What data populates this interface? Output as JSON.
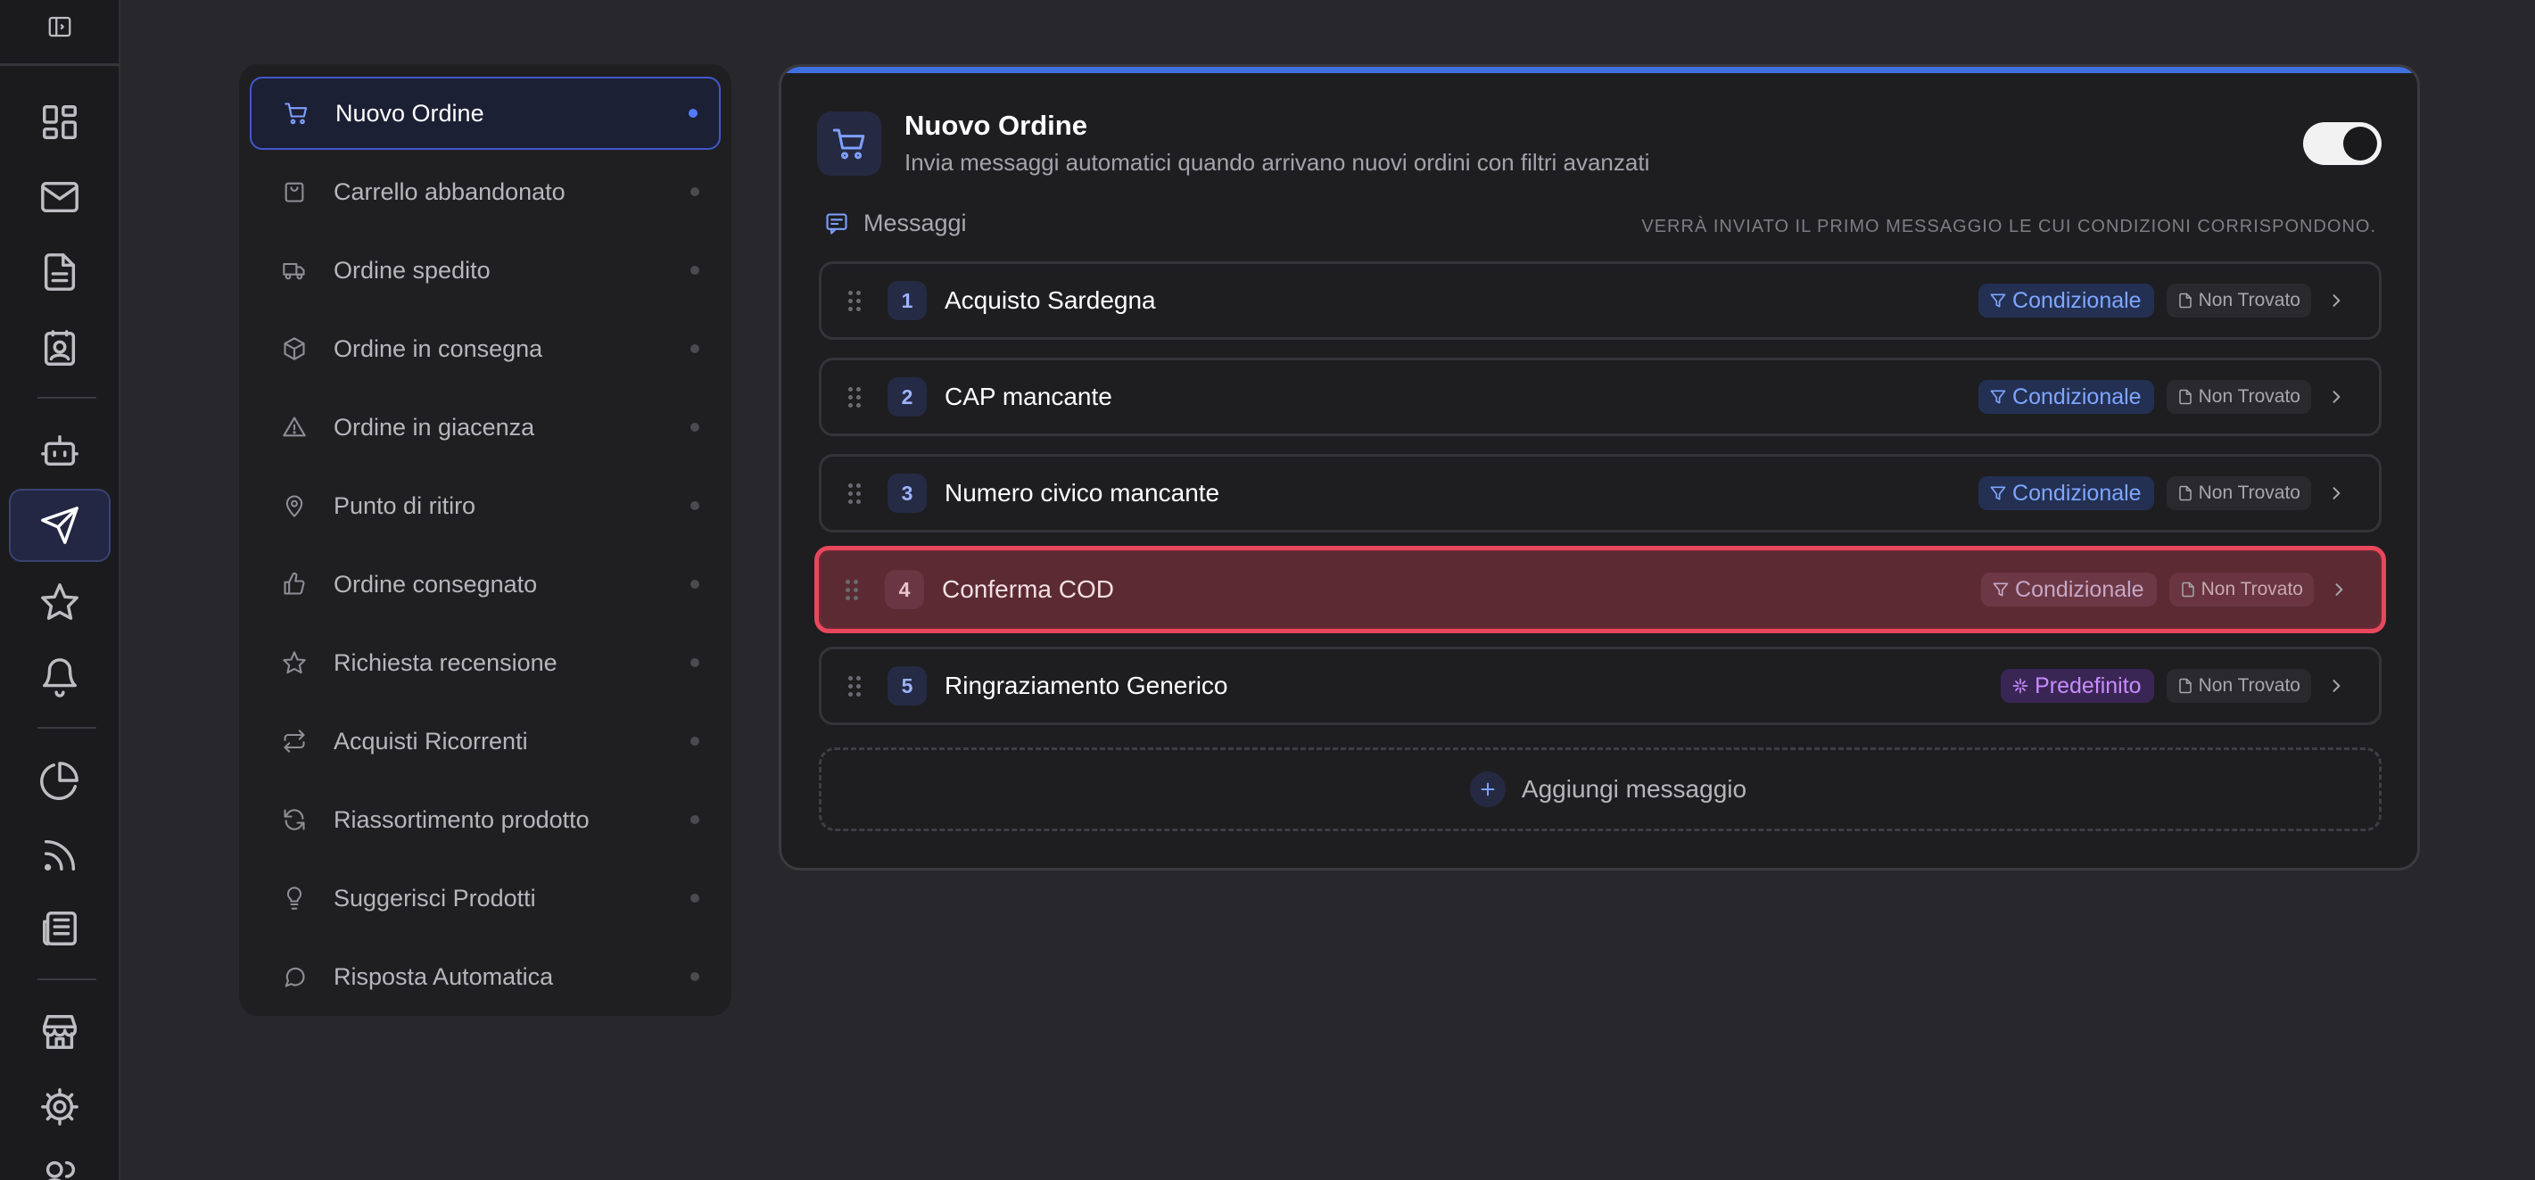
{
  "rail": {
    "icons": [
      "panel-toggle-icon",
      "dashboard-icon",
      "mail-icon",
      "document-icon",
      "contacts-icon",
      "bot-icon",
      "send-icon",
      "star-icon",
      "bell-icon",
      "pie-chart-icon",
      "rss-icon",
      "newspaper-icon",
      "store-icon",
      "settings-icon",
      "users-icon"
    ],
    "active": "send-icon"
  },
  "triggers": [
    {
      "label": "Nuovo Ordine",
      "icon": "cart-icon",
      "active": true
    },
    {
      "label": "Carrello abbandonato",
      "icon": "bag-icon"
    },
    {
      "label": "Ordine spedito",
      "icon": "truck-icon"
    },
    {
      "label": "Ordine in consegna",
      "icon": "package-icon"
    },
    {
      "label": "Ordine in giacenza",
      "icon": "warning-icon"
    },
    {
      "label": "Punto di ritiro",
      "icon": "map-pin-icon"
    },
    {
      "label": "Ordine consegnato",
      "icon": "thumbs-up-icon"
    },
    {
      "label": "Richiesta recensione",
      "icon": "star-icon"
    },
    {
      "label": "Acquisti Ricorrenti",
      "icon": "repeat-icon"
    },
    {
      "label": "Riassortimento prodotto",
      "icon": "refresh-icon"
    },
    {
      "label": "Suggerisci Prodotti",
      "icon": "lightbulb-icon"
    },
    {
      "label": "Risposta Automatica",
      "icon": "chat-bubble-icon"
    }
  ],
  "card": {
    "title": "Nuovo Ordine",
    "subtitle": "Invia messaggi automatici quando arrivano nuovi ordini con filtri avanzati",
    "enabled": true,
    "messages_label": "Messaggi",
    "messages_note": "VERRÀ INVIATO IL PRIMO MESSAGGIO LE CUI CONDIZIONI CORRISPONDONO.",
    "add_label": "Aggiungi messaggio"
  },
  "messages": [
    {
      "num": "1",
      "name": "Acquisto Sardegna",
      "badge": "Condizionale",
      "badge_type": "cond",
      "status": "Non Trovato"
    },
    {
      "num": "2",
      "name": "CAP mancante",
      "badge": "Condizionale",
      "badge_type": "cond",
      "status": "Non Trovato"
    },
    {
      "num": "3",
      "name": "Numero civico mancante",
      "badge": "Condizionale",
      "badge_type": "cond",
      "status": "Non Trovato"
    },
    {
      "num": "4",
      "name": "Conferma COD",
      "badge": "Condizionale",
      "badge_type": "cond",
      "status": "Non Trovato",
      "highlighted": true
    },
    {
      "num": "5",
      "name": "Ringraziamento Generico",
      "badge": "Predefinito",
      "badge_type": "pred",
      "status": "Non Trovato"
    }
  ],
  "colors": {
    "accent": "#4f7bff",
    "highlight_border": "#e8475c",
    "highlight_bg": "#5c2a33"
  }
}
